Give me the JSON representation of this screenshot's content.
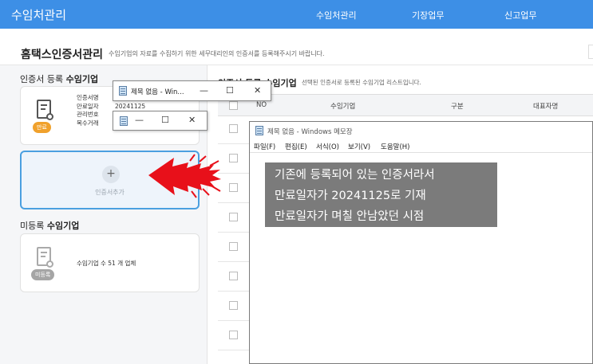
{
  "topbar": {
    "brand": "수임처관리",
    "nav": [
      "수임처관리",
      "기장업무",
      "신고업무"
    ]
  },
  "page": {
    "title": "홈택스인증서관리",
    "subtitle": "수임기업의 자료를 수집하기 위한 세무대리인의 인증서를 등록해주시기 바랍니다."
  },
  "registered": {
    "title_normal": "인증서 등록 ",
    "title_bold": "수임기업",
    "card": {
      "labels": [
        "인증서명",
        "만료일자",
        "관리번호",
        "복수거래"
      ],
      "expiry_value": "20241125",
      "badge": "만료"
    },
    "add_label": "인증서추가"
  },
  "unregistered": {
    "title_normal": "미등록 ",
    "title_bold": "수임기업",
    "count_text": "수임기업 수  51 개 업체",
    "badge": "미등록"
  },
  "table": {
    "title": "인증서 등록 수임기업",
    "subtitle": "선택된 인증서로 등록된 수임기업 리스트입니다.",
    "columns": [
      "NO",
      "수임기업",
      "구분",
      "대표자명"
    ]
  },
  "notepad_small": {
    "title": "제목 없음 - Win...",
    "minimize": "—",
    "maximize": "☐",
    "close": "✕"
  },
  "notepad_tiny": {
    "minimize": "—",
    "maximize": "☐",
    "close": "✕"
  },
  "notepad_main": {
    "title": "제목 없음 - Windows 메모장",
    "menu": [
      "파일(F)",
      "편집(E)",
      "서식(O)",
      "보기(V)",
      "도움말(H)"
    ],
    "lines": [
      "기존에 등록되어 있는 인증서라서",
      "만료일자가 20241125로 기재",
      "만료일자가 며칠 안남았던 시점"
    ]
  },
  "colors": {
    "topbar": "#3d8fe6",
    "add_border": "#4a9fe0",
    "badge_done": "#f0a12c",
    "arrow": "#e8101a"
  },
  "icons": [
    "certificate-icon",
    "plus-icon",
    "notepad-icon",
    "red-arrow"
  ]
}
